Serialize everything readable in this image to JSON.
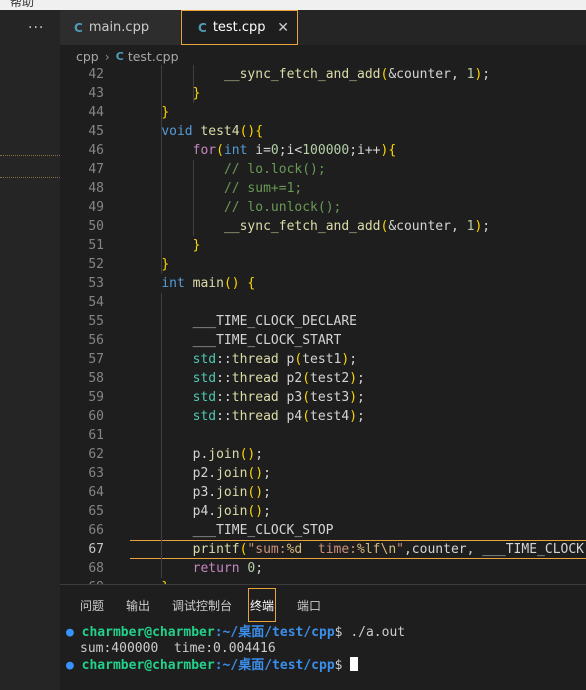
{
  "menubar": {
    "label": "帮助"
  },
  "sidebar": {
    "more_label": "···"
  },
  "tabs": [
    {
      "label": "main.cpp",
      "icon": "c-plus-plus-icon",
      "active": false
    },
    {
      "label": "test.cpp",
      "icon": "c-plus-plus-icon",
      "active": true,
      "close": "✕"
    }
  ],
  "breadcrumb": {
    "folder": "cpp",
    "separator": "›",
    "file": "test.cpp"
  },
  "editor": {
    "current_line": 67,
    "lines": [
      {
        "n": "42",
        "code": "            __sync_fetch_and_add(&counter, 1);"
      },
      {
        "n": "43",
        "code": "        }"
      },
      {
        "n": "44",
        "code": "    }"
      },
      {
        "n": "45",
        "code": "    void test4(){"
      },
      {
        "n": "46",
        "code": "        for(int i=0;i<100000;i++){"
      },
      {
        "n": "47",
        "code": "            // lo.lock();"
      },
      {
        "n": "48",
        "code": "            // sum+=1;"
      },
      {
        "n": "49",
        "code": "            // lo.unlock();"
      },
      {
        "n": "50",
        "code": "            __sync_fetch_and_add(&counter, 1);"
      },
      {
        "n": "51",
        "code": "        }"
      },
      {
        "n": "52",
        "code": "    }"
      },
      {
        "n": "53",
        "code": "    int main() {"
      },
      {
        "n": "54",
        "code": ""
      },
      {
        "n": "55",
        "code": "        ___TIME_CLOCK_DECLARE"
      },
      {
        "n": "56",
        "code": "        ___TIME_CLOCK_START"
      },
      {
        "n": "57",
        "code": "        std::thread p(test1);"
      },
      {
        "n": "58",
        "code": "        std::thread p2(test2);"
      },
      {
        "n": "59",
        "code": "        std::thread p3(test3);"
      },
      {
        "n": "60",
        "code": "        std::thread p4(test4);"
      },
      {
        "n": "61",
        "code": ""
      },
      {
        "n": "62",
        "code": "        p.join();"
      },
      {
        "n": "63",
        "code": "        p2.join();"
      },
      {
        "n": "64",
        "code": "        p3.join();"
      },
      {
        "n": "65",
        "code": "        p4.join();"
      },
      {
        "n": "66",
        "code": "        ___TIME_CLOCK_STOP"
      },
      {
        "n": "67",
        "code": "        printf(\"sum:%d  time:%lf\\n\",counter, ___TIME_CLOCK"
      },
      {
        "n": "68",
        "code": "        return 0;"
      },
      {
        "n": "69",
        "code": "    }"
      }
    ]
  },
  "panel": {
    "tabs": [
      "问题",
      "输出",
      "调试控制台",
      "终端",
      "端口"
    ],
    "active_tab": "终端"
  },
  "terminal": {
    "user": "charmber@charmber",
    "path_prefix": ":~/",
    "path_cn": "桌面",
    "path_rest": "/test/cpp",
    "prompt_symbol": "$",
    "command": " ./a.out",
    "output": "sum:400000  time:0.004416"
  },
  "colors": {
    "accent_border": "#e8a33d",
    "keyword": "#569cd6",
    "function": "#dcdcaa",
    "comment": "#6a9955",
    "string": "#ce9178",
    "terminal_user": "#23d18b",
    "terminal_path": "#3b8eea"
  }
}
